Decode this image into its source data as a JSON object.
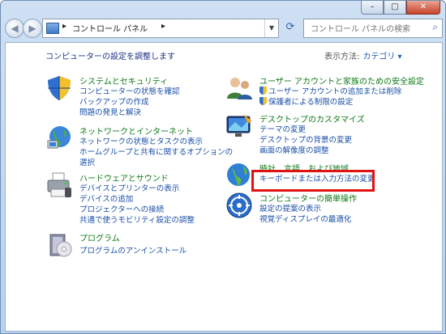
{
  "window": {
    "buttons": [
      "–",
      "□",
      "✕"
    ]
  },
  "nav": {
    "breadcrumb": "コントロール パネル",
    "search_placeholder": "コントロール パネルの検索"
  },
  "main": {
    "header": "コンピューターの設定を調整します",
    "viewby_label": "表示方法:",
    "viewby_value": "カテゴリ ▾"
  },
  "categories": {
    "system": {
      "title": "システムとセキュリティ",
      "links": [
        "コンピューターの状態を確認",
        "バックアップの作成",
        "問題の発見と解決"
      ]
    },
    "network": {
      "title": "ネットワークとインターネット",
      "links": [
        "ネットワークの状態とタスクの表示",
        "ホームグループと共有に関するオプションの",
        "選択"
      ]
    },
    "hardware": {
      "title": "ハードウェアとサウンド",
      "links": [
        "デバイスとプリンターの表示",
        "デバイスの追加",
        "プロジェクターへの接続",
        "共通で使うモビリティ設定の調整"
      ]
    },
    "programs": {
      "title": "プログラム",
      "links": [
        "プログラムのアンインストール"
      ]
    },
    "users": {
      "title": "ユーザー アカウントと家族のための安全設定",
      "links": [
        "ユーザー アカウントの追加または削除",
        "保護者による制限の設定"
      ]
    },
    "appearance": {
      "title": "デスクトップのカスタマイズ",
      "links": [
        "テーマの変更",
        "デスクトップの背景の変更",
        "画面の解像度の調整"
      ]
    },
    "clock": {
      "title": "時計、言語、および地域",
      "links": [
        "キーボードまたは入力方法の変更"
      ]
    },
    "access": {
      "title": "コンピューターの簡単操作",
      "links": [
        "設定の提案の表示",
        "視覚ディスプレイの最適化"
      ]
    }
  }
}
